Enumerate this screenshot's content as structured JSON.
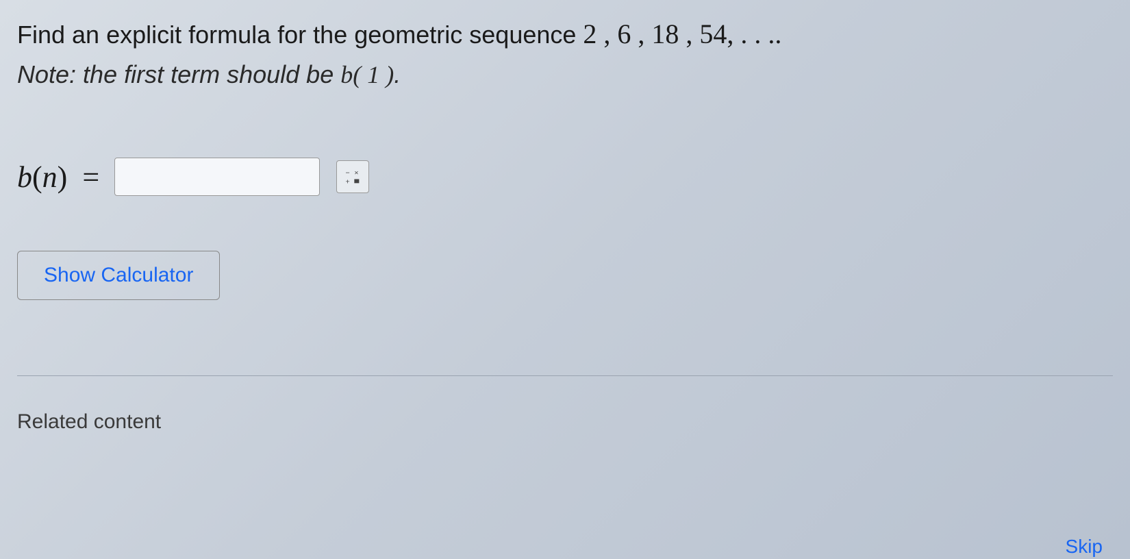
{
  "question": {
    "prefix": "Find an explicit formula for the geometric sequence ",
    "sequence": "2 ,  6 ,  18 ,  54, . . ..",
    "note_prefix": "Note: the first term should be ",
    "note_math": "b( 1 )",
    "note_suffix": "."
  },
  "answer": {
    "label_var": "b",
    "label_inner": "n",
    "equals": "=",
    "input_value": ""
  },
  "buttons": {
    "show_calculator": "Show Calculator"
  },
  "footer": {
    "related": "Related content",
    "skip": "Skip"
  }
}
